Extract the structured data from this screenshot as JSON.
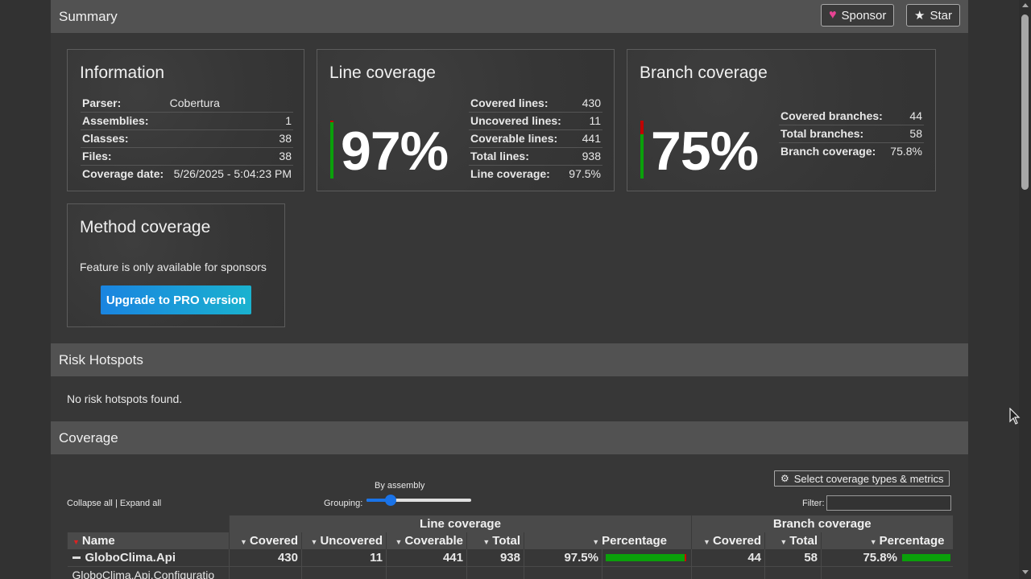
{
  "summary": {
    "title": "Summary",
    "sponsor_label": "Sponsor",
    "star_label": "Star"
  },
  "information": {
    "title": "Information",
    "rows": [
      {
        "key": "Parser:",
        "value": "Cobertura"
      },
      {
        "key": "Assemblies:",
        "value": "1"
      },
      {
        "key": "Classes:",
        "value": "38"
      },
      {
        "key": "Files:",
        "value": "38"
      },
      {
        "key": "Coverage date:",
        "value": "5/26/2025 - 5:04:23 PM"
      }
    ]
  },
  "line_coverage": {
    "title": "Line coverage",
    "percent": "97%",
    "bar_fraction": 0.975,
    "rows": [
      {
        "key": "Covered lines:",
        "value": "430"
      },
      {
        "key": "Uncovered lines:",
        "value": "11"
      },
      {
        "key": "Coverable lines:",
        "value": "441"
      },
      {
        "key": "Total lines:",
        "value": "938"
      },
      {
        "key": "Line coverage:",
        "value": "97.5%"
      }
    ]
  },
  "branch_coverage": {
    "title": "Branch coverage",
    "percent": "75%",
    "bar_fraction": 0.758,
    "rows": [
      {
        "key": "Covered branches:",
        "value": "44"
      },
      {
        "key": "Total branches:",
        "value": "58"
      },
      {
        "key": "Branch coverage:",
        "value": "75.8%"
      }
    ]
  },
  "method_coverage": {
    "title": "Method coverage",
    "message": "Feature is only available for sponsors",
    "upgrade_label": "Upgrade to PRO version"
  },
  "risk_hotspots": {
    "title": "Risk Hotspots",
    "message": "No risk hotspots found."
  },
  "coverage": {
    "title": "Coverage",
    "select_types_label": "Select coverage types & metrics",
    "collapse_all": "Collapse all",
    "separator": "|",
    "expand_all": "Expand all",
    "grouping_label": "Grouping:",
    "grouping_value": "By assembly",
    "grouping_level": 0.2,
    "filter_label": "Filter:",
    "filter_value": "",
    "group_headers": {
      "line": "Line coverage",
      "branch": "Branch coverage"
    },
    "columns": {
      "name": "Name",
      "covered": "Covered",
      "uncovered": "Uncovered",
      "coverable": "Coverable",
      "total": "Total",
      "percentage": "Percentage",
      "b_covered": "Covered",
      "b_total": "Total",
      "b_percentage": "Percentage"
    },
    "assembly_row": {
      "name": "GloboClima.Api",
      "covered": "430",
      "uncovered": "11",
      "coverable": "441",
      "total": "938",
      "percentage": "97.5%",
      "line_fraction": 0.975,
      "b_covered": "44",
      "b_total": "58",
      "b_percentage": "75.8%",
      "branch_fraction": 0.758
    },
    "class_row": {
      "name": "GloboClima.Api.Configuratio"
    }
  },
  "colors": {
    "covered": "#0aa00a",
    "uncovered": "#c00000",
    "accent_pink": "#e84393"
  }
}
